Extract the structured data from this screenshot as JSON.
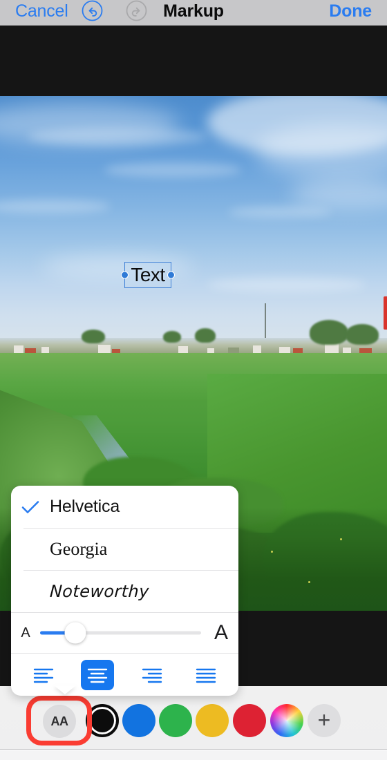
{
  "toolbar": {
    "cancel_label": "Cancel",
    "title": "Markup",
    "done_label": "Done",
    "undo_icon": "undo-icon",
    "redo_icon": "redo-icon",
    "undo_enabled": "true",
    "redo_enabled": "false",
    "accent_color": "#2a7cf0",
    "background_color": "#c7c7c9"
  },
  "canvas": {
    "text_object": {
      "value": "Text",
      "selected": "true",
      "handle_left": "resize-handle-left",
      "handle_right": "resize-handle-right",
      "selection_color": "#3d7fd6"
    },
    "letterbox_color": "#151515",
    "photo_description": "rice paddy field with canal and village on horizon under blue sky"
  },
  "font_popover": {
    "fonts": [
      {
        "name": "Helvetica",
        "selected": "true"
      },
      {
        "name": "Georgia",
        "selected": "false"
      },
      {
        "name": "Noteworthy",
        "selected": "false"
      }
    ],
    "checkmark_icon": "checkmark-icon",
    "size_slider": {
      "min_label": "A",
      "max_label": "A",
      "value_percent": 22,
      "fill_color": "#2a7cf0",
      "track_color": "#e4e4e6"
    },
    "alignment": {
      "options": [
        {
          "name": "align-left",
          "label": "Align Left",
          "selected": "false"
        },
        {
          "name": "align-center",
          "label": "Align Center",
          "selected": "true"
        },
        {
          "name": "align-right",
          "label": "Align Right",
          "selected": "false"
        },
        {
          "name": "align-justify",
          "label": "Justify",
          "selected": "false"
        }
      ],
      "selected_color": "#1677ef",
      "icon_color": "#1677ef"
    }
  },
  "bottom_bar": {
    "text_style_button": {
      "label": "AA",
      "name": "text-style-button",
      "highlighted": "true",
      "highlight_color": "#fa3c32"
    },
    "swatches": [
      {
        "name": "color-black",
        "color": "#0c0c0c",
        "selected": "true"
      },
      {
        "name": "color-blue",
        "color": "#1273e0",
        "selected": "false"
      },
      {
        "name": "color-green",
        "color": "#2db34c",
        "selected": "false"
      },
      {
        "name": "color-yellow",
        "color": "#edbb22",
        "selected": "false"
      },
      {
        "name": "color-red",
        "color": "#dd2233",
        "selected": "false"
      },
      {
        "name": "color-wheel",
        "color": "rainbow",
        "selected": "false"
      }
    ],
    "add_color_label": "+",
    "background_color": "#f0f0f0"
  }
}
